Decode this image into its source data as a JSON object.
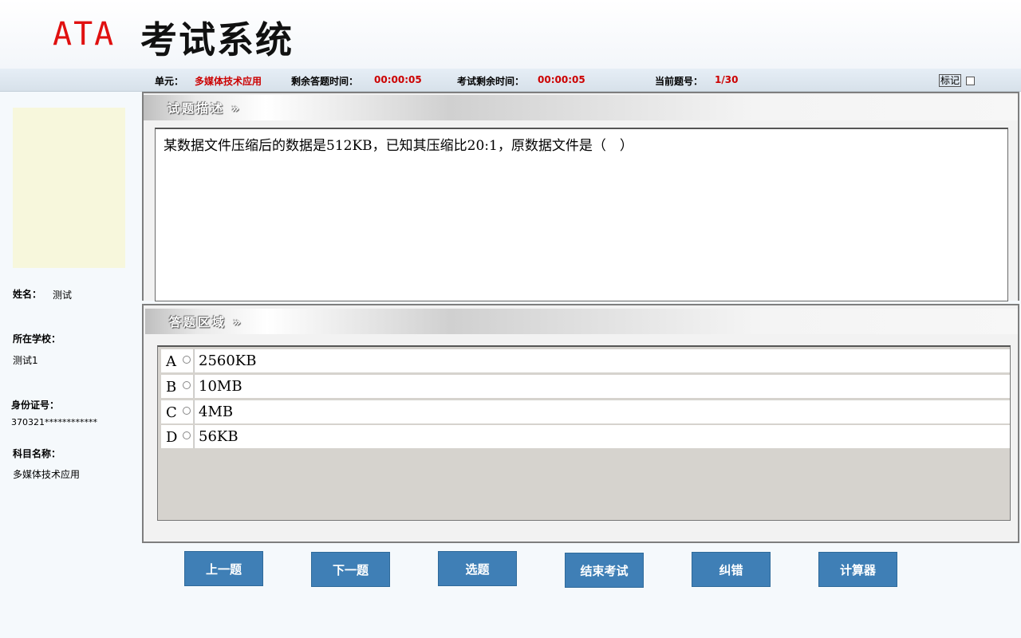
{
  "header": {
    "logo": "ATA",
    "title": "考试系统"
  },
  "infobar": {
    "unit_label": "单元：",
    "unit_value": "多媒体技术应用",
    "answer_time_label": "剩余答题时间：",
    "answer_time_value": "00:00:05",
    "exam_time_label": "考试剩余时间：",
    "exam_time_value": "00:00:05",
    "current_label": "当前题号：",
    "current_value": "1/30",
    "mark_label": "标记"
  },
  "sidebar": {
    "name_label": "姓名：",
    "name_value": "测试",
    "school_label": "所在学校：",
    "school_value": "测试1",
    "id_label": "身份证号：",
    "id_value": "370321************",
    "subject_label": "科目名称：",
    "subject_value": "多媒体技术应用"
  },
  "question": {
    "header": "试题描述 »",
    "text": "某数据文件压缩后的数据是512KB，已知其压缩比20:1，原数据文件是（　）"
  },
  "answer": {
    "header": "答题区域 »",
    "options": [
      {
        "letter": "A",
        "text": "2560KB"
      },
      {
        "letter": "B",
        "text": "10MB"
      },
      {
        "letter": "C",
        "text": "4MB"
      },
      {
        "letter": "D",
        "text": "56KB"
      }
    ]
  },
  "buttons": {
    "prev": "上一题",
    "next": "下一题",
    "select": "选题",
    "end": "结束考试",
    "correct": "纠错",
    "calculator": "计算器"
  },
  "colors": {
    "accent": "#3f7fb6",
    "highlight": "#cc0000",
    "photo_bg": "#f7f7dc"
  }
}
